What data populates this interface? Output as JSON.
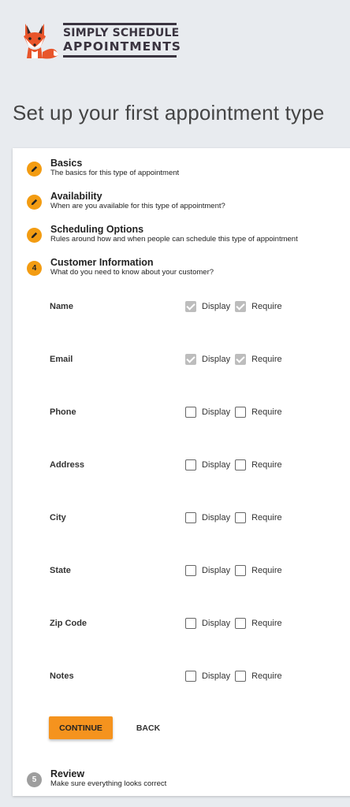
{
  "brand": {
    "line1": "SIMPLY SCHEDULE",
    "line2": "APPOINTMENTS"
  },
  "page_title": "Set up your first appointment type",
  "steps": [
    {
      "number": "",
      "title": "Basics",
      "subtitle": "The basics for this type of appointment",
      "state": "completed",
      "icon": "pencil-icon"
    },
    {
      "number": "",
      "title": "Availability",
      "subtitle": "When are you available for this type of appointment?",
      "state": "completed",
      "icon": "pencil-icon"
    },
    {
      "number": "",
      "title": "Scheduling Options",
      "subtitle": "Rules around how and when people can schedule this type of appointment",
      "state": "completed",
      "icon": "pencil-icon"
    },
    {
      "number": "4",
      "title": "Customer Information",
      "subtitle": "What do you need to know about your customer?",
      "state": "active"
    },
    {
      "number": "5",
      "title": "Review",
      "subtitle": "Make sure everything looks correct",
      "state": "pending"
    }
  ],
  "customer_fields": {
    "display_label": "Display",
    "require_label": "Require",
    "fields": [
      {
        "name": "Name",
        "display": true,
        "require": true
      },
      {
        "name": "Email",
        "display": true,
        "require": true
      },
      {
        "name": "Phone",
        "display": false,
        "require": false
      },
      {
        "name": "Address",
        "display": false,
        "require": false
      },
      {
        "name": "City",
        "display": false,
        "require": false
      },
      {
        "name": "State",
        "display": false,
        "require": false
      },
      {
        "name": "Zip Code",
        "display": false,
        "require": false
      },
      {
        "name": "Notes",
        "display": false,
        "require": false
      }
    ]
  },
  "buttons": {
    "continue": "CONTINUE",
    "back": "BACK"
  },
  "colors": {
    "accent": "#f39c12",
    "button": "#f5931e",
    "background": "#e8ebef",
    "brand_text": "#3a3440"
  }
}
